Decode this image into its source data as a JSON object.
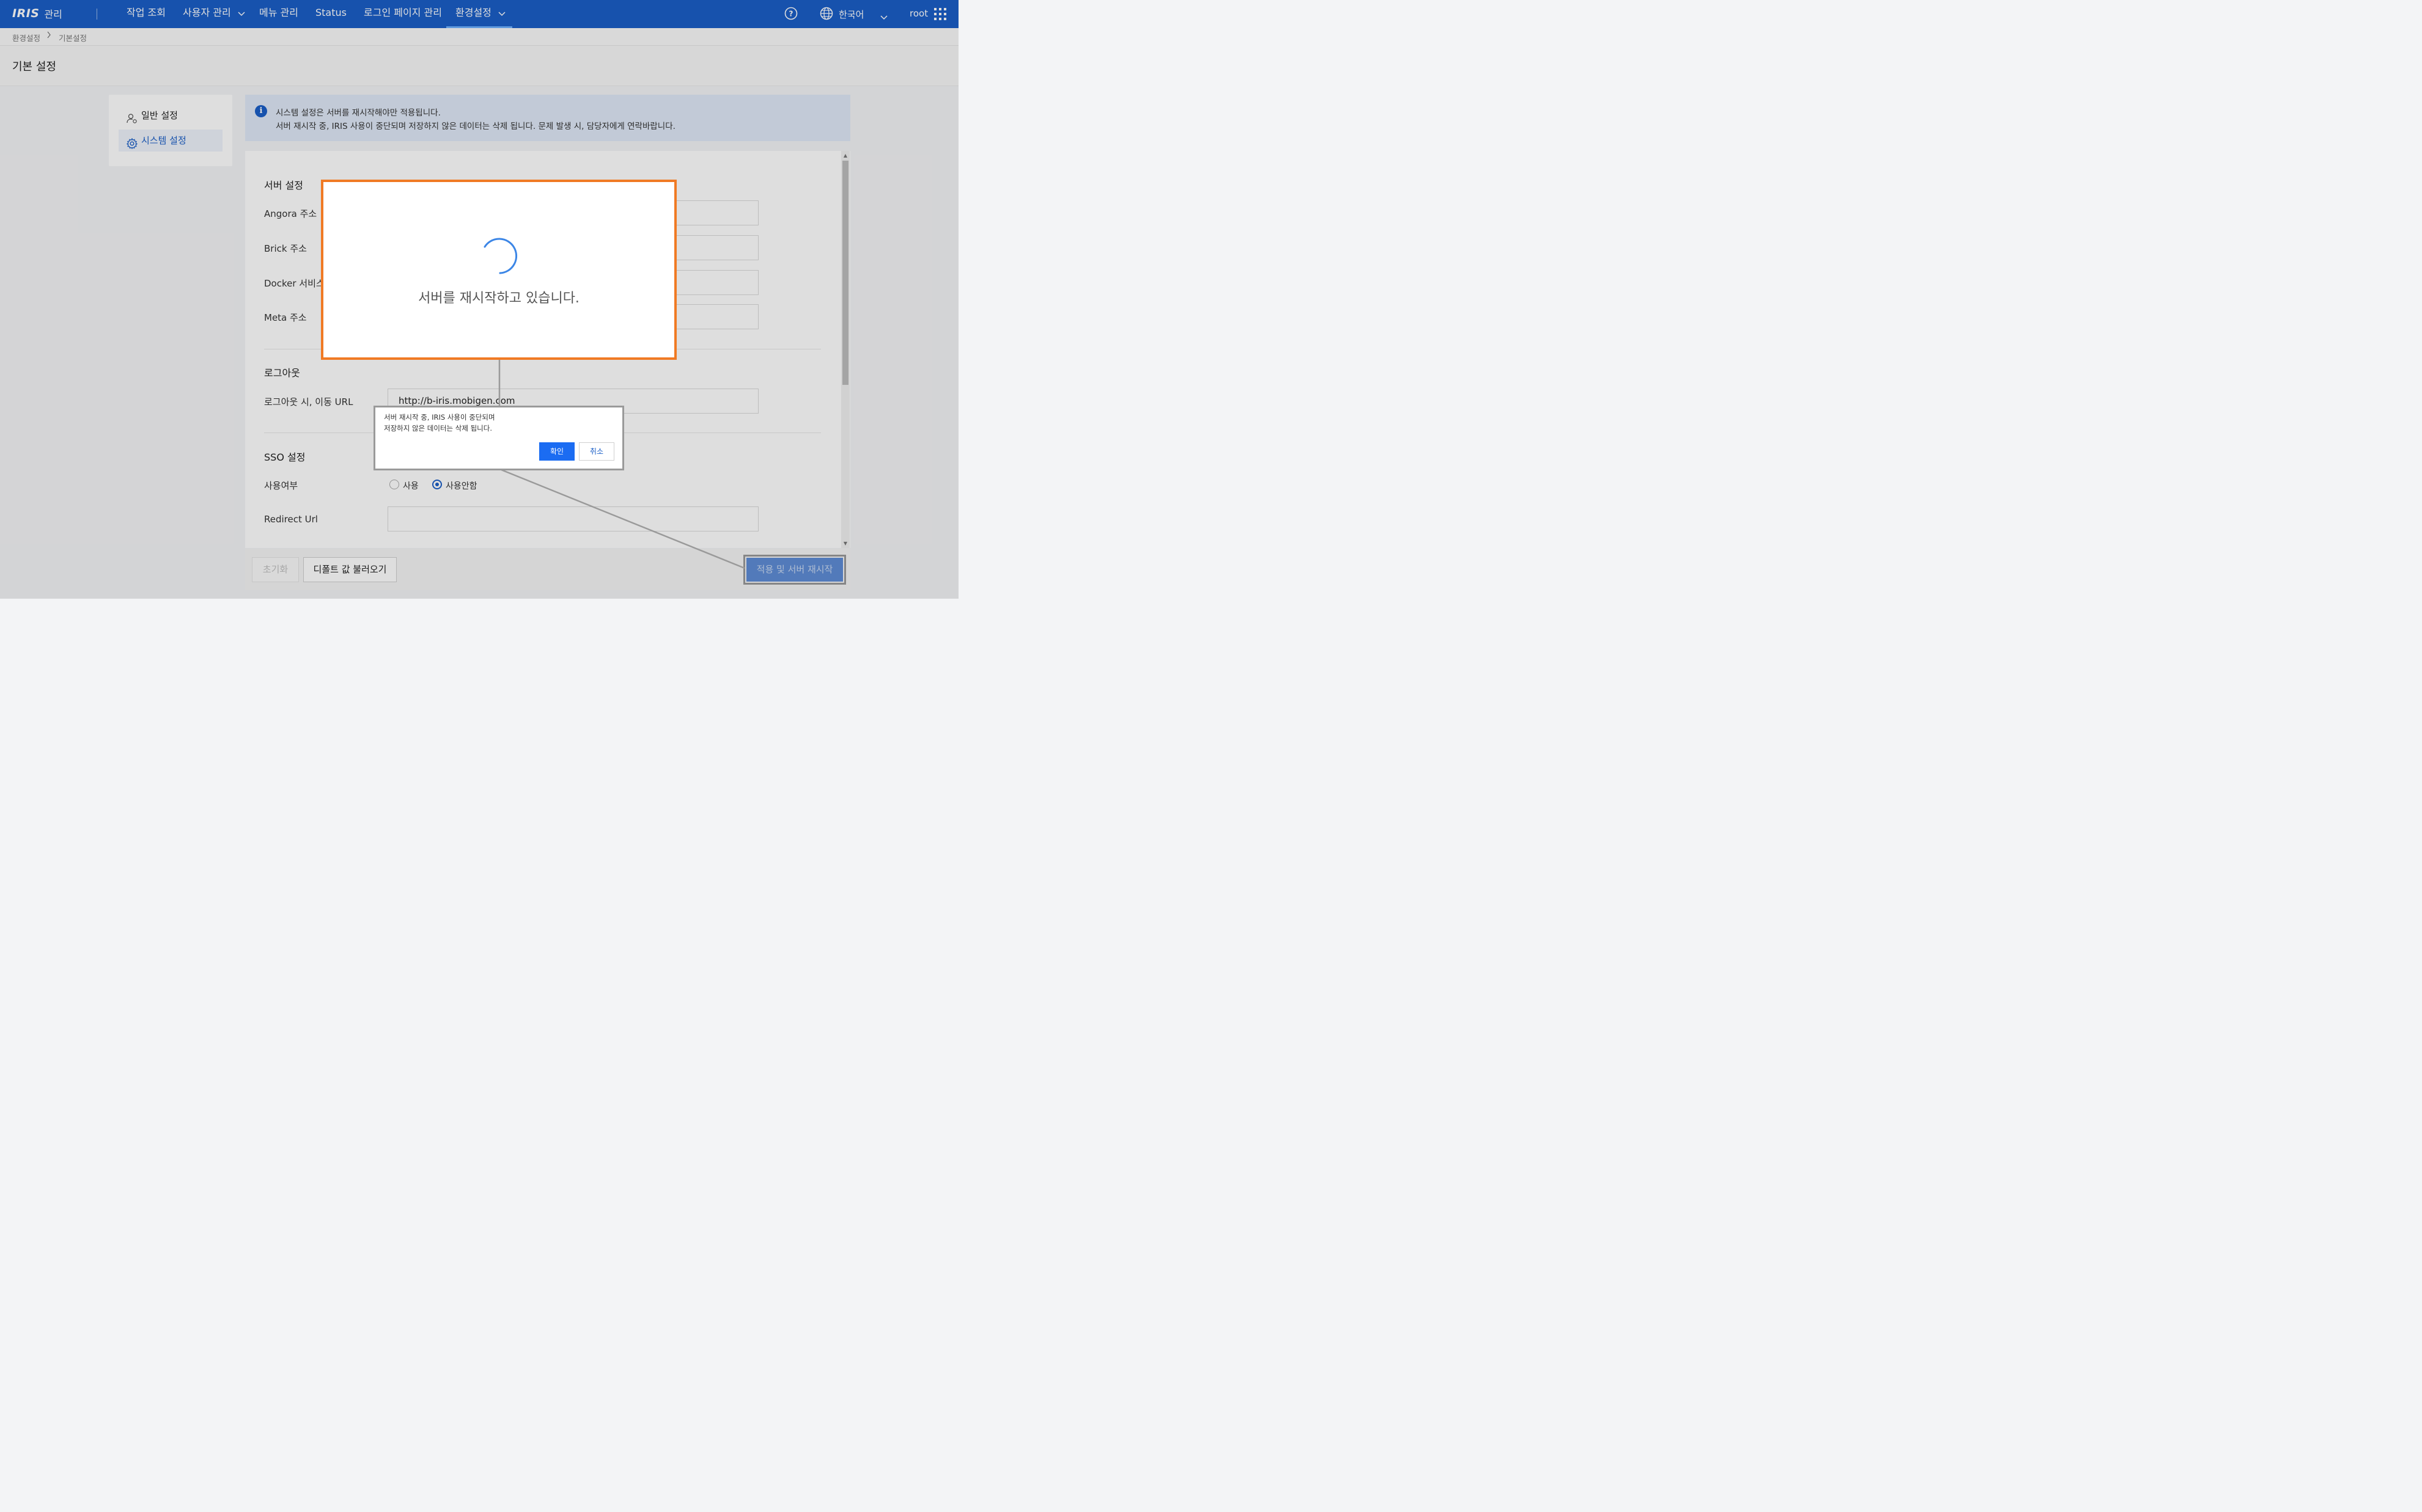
{
  "header": {
    "logo": "IRIS",
    "logo_sub": "관리",
    "nav": [
      "작업 조회",
      "사용자 관리",
      "메뉴 관리",
      "Status",
      "로그인 페이지 관리",
      "환경설정"
    ],
    "language": "한국어",
    "user": "root",
    "accent_color": "#1b5fc7"
  },
  "breadcrumb": [
    "환경설정",
    "기본설정"
  ],
  "page_title": "기본 설정",
  "sidebar": {
    "items": [
      {
        "label": "일반 설정",
        "icon": "user-gear-icon"
      },
      {
        "label": "시스템 설정",
        "icon": "gear-icon",
        "active": true
      }
    ]
  },
  "info": {
    "line1": "시스템 설정은 서버를 재시작해야만 적용됩니다.",
    "line2": "서버 재시작 중, IRIS 사용이 중단되며 저장하지 않은 데이터는 삭제 됩니다. 문제 발생 시, 담당자에게 연락바랍니다."
  },
  "form": {
    "server_section": "서버 설정",
    "angora_label": "Angora 주소",
    "brick_label": "Brick 주소",
    "docker_label": "Docker 서비스",
    "meta_label": "Meta 주소",
    "logout_section": "로그아웃",
    "logout_url_label": "로그아웃 시, 이동 URL",
    "logout_url_value": "http://b-iris.mobigen.com",
    "sso_section": "SSO 설정",
    "sso_use_label": "사용여부",
    "sso_use_options": [
      "사용",
      "사용안함"
    ],
    "sso_selected": "사용안함",
    "redirect_label": "Redirect Url",
    "redirect_value": ""
  },
  "actions": {
    "reset": "초기화",
    "load_default": "디폴트 값 불러오기",
    "apply_restart": "적용 및 서버 재시작"
  },
  "loading_modal": {
    "message": "서버를 재시작하고 있습니다."
  },
  "confirm_dialog": {
    "line1": "서버 재시작 중, IRIS 사용이 중단되며",
    "line2": "저장하지 않은 데이터는 삭제 됩니다.",
    "ok": "확인",
    "cancel": "취소"
  }
}
